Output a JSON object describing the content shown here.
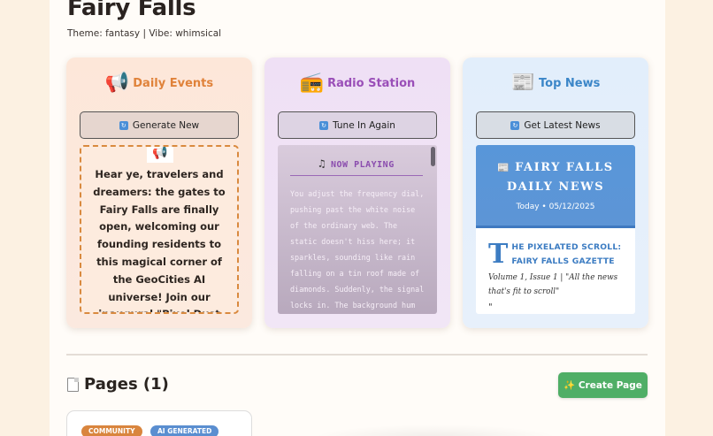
{
  "site": {
    "title": "Fairy Falls",
    "subtitle": "Theme: fantasy | Vibe: whimsical"
  },
  "cards": {
    "events": {
      "icon": "megaphone-icon",
      "title": "Daily Events",
      "button": "Generate New",
      "text": "Hear ye, travelers and dreamers: the gates to Fairy Falls are finally open, welcoming our founding residents to this magical corner of the GeoCities AI universe! Join our inaugural \"Pixel Dust"
    },
    "radio": {
      "icon": "radio-icon",
      "title": "Radio Station",
      "button": "Tune In Again",
      "now_playing": "NOW PLAYING",
      "text": "You adjust the frequency dial, pushing past the white noise of the ordinary web. The static doesn't hiss here; it sparkles, sounding like rain falling on a tin roof made of diamonds. Suddenly, the signal locks in. The background hum isn't"
    },
    "news": {
      "icon": "newspaper-icon",
      "title": "Top News",
      "button": "Get Latest News",
      "banner_line1": "FAIRY FALLS",
      "banner_line2": "DAILY NEWS",
      "date": "Today • 05/12/2025",
      "dropcap": "T",
      "headline": "HE PIXELATED SCROLL: FAIRY FALLS GAZETTE",
      "meta": "Volume 1, Issue 1 | \"All the news that's fit to scroll\"",
      "cut": "\""
    }
  },
  "pages": {
    "title": "Pages (1)",
    "create_button": "✨ Create Page",
    "tags": [
      "COMMUNITY",
      "AI GENERATED"
    ]
  },
  "colors": {
    "events_accent": "#e0823a",
    "radio_accent": "#9a4fb8",
    "news_accent": "#3b86c8",
    "create_button": "#4fae66"
  }
}
